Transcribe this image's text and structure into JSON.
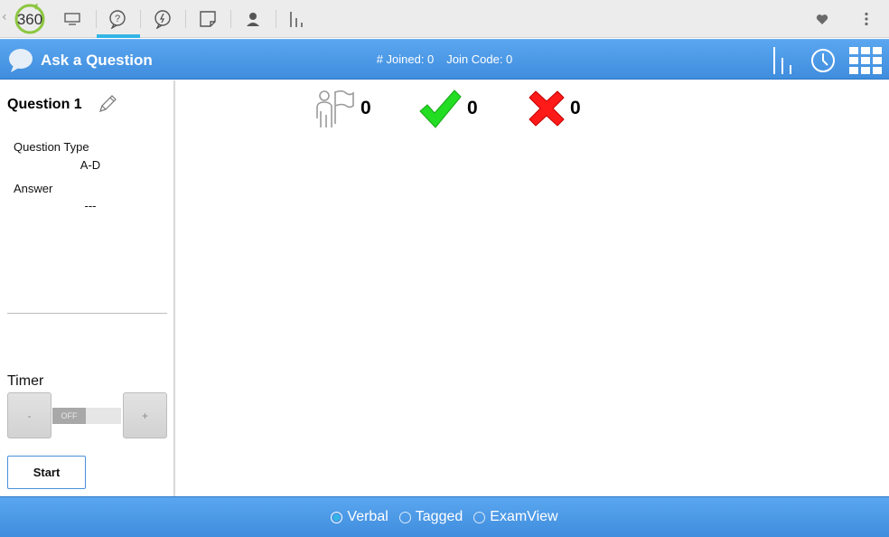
{
  "toolbar": {
    "logo_text": "360",
    "tabs": [
      {
        "icon": "monitor-icon"
      },
      {
        "icon": "question-bubble-icon",
        "active": true
      },
      {
        "icon": "lightning-bubble-icon"
      },
      {
        "icon": "note-icon"
      },
      {
        "icon": "student-icon"
      },
      {
        "icon": "bar-chart-icon"
      }
    ],
    "right_icons": [
      "heart-icon",
      "overflow-menu-icon"
    ]
  },
  "header": {
    "title": "Ask a Question",
    "joined": "# Joined: 0",
    "join_code": "Join Code: 0",
    "icons": [
      "bar-chart-icon",
      "clock-icon",
      "grid-icon"
    ]
  },
  "question": {
    "title": "Question 1",
    "type_label": "Question Type",
    "type_value": "A-D",
    "answer_label": "Answer",
    "answer_value": "---"
  },
  "timer": {
    "label": "Timer",
    "minus": "-",
    "plus": "+",
    "toggle_state": "OFF"
  },
  "start_label": "Start",
  "stats": {
    "responded": "0",
    "correct": "0",
    "incorrect": "0"
  },
  "modes": [
    {
      "label": "Verbal",
      "selected": true
    },
    {
      "label": "Tagged",
      "selected": false
    },
    {
      "label": "ExamView",
      "selected": false
    }
  ],
  "colors": {
    "header_blue": "#4a97e6",
    "accent": "#33b5e5",
    "correct_green": "#22dd22",
    "incorrect_red": "#ff1a1a"
  }
}
